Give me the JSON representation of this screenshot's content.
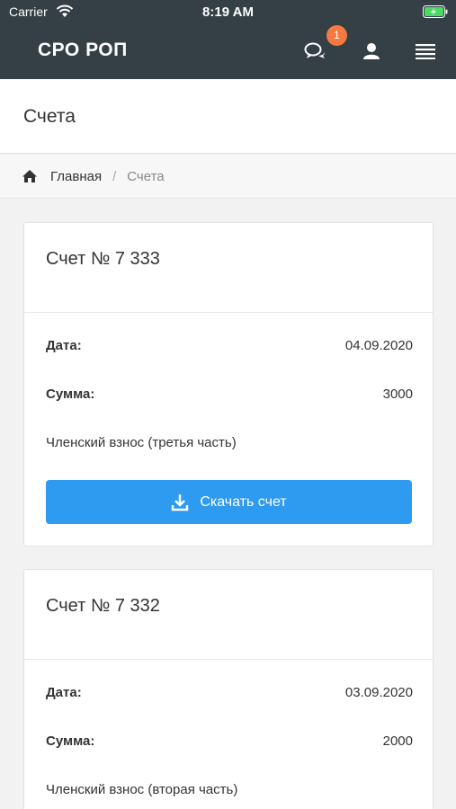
{
  "status_bar": {
    "carrier": "Carrier",
    "time": "8:19 AM"
  },
  "header": {
    "brand": "СРО РОП",
    "notifications_count": "1"
  },
  "page": {
    "title": "Счета"
  },
  "breadcrumb": {
    "home": "Главная",
    "separator": "/",
    "current": "Счета"
  },
  "invoices": [
    {
      "title": "Счет № 7 333",
      "date_label": "Дата:",
      "date": "04.09.2020",
      "sum_label": "Сумма:",
      "sum": "3000",
      "description": "Членский взнос (третья часть)",
      "download_label": "Скачать счет"
    },
    {
      "title": "Счет № 7 332",
      "date_label": "Дата:",
      "date": "03.09.2020",
      "sum_label": "Сумма:",
      "sum": "2000",
      "description": "Членский взнос (вторая часть)"
    }
  ],
  "colors": {
    "topbar": "#343f46",
    "accent": "#2e9af0",
    "badge": "#f47a42"
  }
}
